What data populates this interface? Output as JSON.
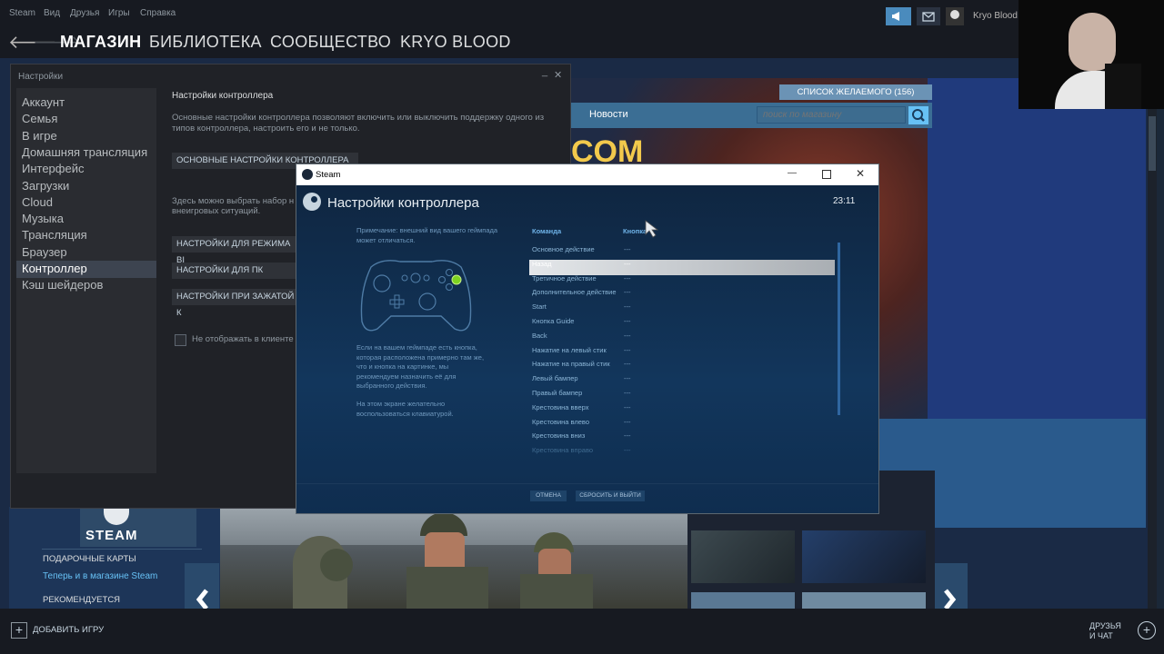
{
  "topmenu": {
    "items": [
      "Steam",
      "Вид",
      "Друзья",
      "Игры",
      "Справка"
    ]
  },
  "nav": {
    "tabs": [
      "МАГАЗИН",
      "БИБЛИОТЕКА",
      "СООБЩЕСТВО",
      "KRYO BLOOD"
    ],
    "username": "Kryo Blood"
  },
  "store": {
    "wishlist": "СПИСОК ЖЕЛАЕМОГО (156)",
    "news": "Новости",
    "search_placeholder": "поиск по магазину",
    "brand_fragment": "COM",
    "steam_logo": "STEAM",
    "gift_cards": "ПОДАРОЧНЫЕ КАРТЫ",
    "now_in_store": "Теперь и в магазине Steam",
    "recommended": "РЕКОМЕНДУЕТСЯ"
  },
  "settings": {
    "title": "Настройки",
    "close_label": "✕",
    "min_label": "_",
    "sidebar": [
      "Аккаунт",
      "Семья",
      "В игре",
      "Домашняя трансляция",
      "Интерфейс",
      "Загрузки",
      "Cloud",
      "Музыка",
      "Трансляция",
      "Браузер",
      "Контроллер",
      "Кэш шейдеров"
    ],
    "active_index": 10,
    "section_title": "Настройки контроллера",
    "section_desc": "Основные настройки контроллера позволяют включить или выключить поддержку одного из типов контроллера, настроить его и не только.",
    "btn_general": "ОСНОВНЫЕ НАСТРОЙКИ КОНТРОЛЛЕРА",
    "para2_line1": "Здесь можно выбрать набор н",
    "para2_line2": "внеигровых ситуаций.",
    "btn_bigpicture": "НАСТРОЙКИ ДЛЯ РЕЖИМА BI",
    "btn_pc": "НАСТРОЙКИ ДЛЯ ПК",
    "btn_hold": "НАСТРОЙКИ ПРИ ЗАЖАТОЙ К",
    "checkbox_label": "Не отображать в клиенте"
  },
  "dialog": {
    "window_title": "Steam",
    "title": "Настройки контроллера",
    "clock": "23:11",
    "note": "Примечание: внешний вид вашего геймпада может отличаться.",
    "help1": "Если на вашем геймпаде есть кнопка, которая расположена примерно там же, что и кнопка на картинке, мы рекомендуем назначить её для выбранного действия.",
    "help2": "На этом экране желательно воспользоваться клавиатурой.",
    "col_command": "Команда",
    "col_button": "Кнопка",
    "rows": [
      {
        "command": "Основное действие",
        "key": "---"
      },
      {
        "command": "Назад",
        "key": "---"
      },
      {
        "command": "Третичное действие",
        "key": "---"
      },
      {
        "command": "Дополнительное действие",
        "key": "---"
      },
      {
        "command": "Start",
        "key": "---"
      },
      {
        "command": "Кнопка Guide",
        "key": "---"
      },
      {
        "command": "Back",
        "key": "---"
      },
      {
        "command": "Нажатие на левый стик",
        "key": "---"
      },
      {
        "command": "Нажатие на правый стик",
        "key": "---"
      },
      {
        "command": "Левый бампер",
        "key": "---"
      },
      {
        "command": "Правый бампер",
        "key": "---"
      },
      {
        "command": "Крестовина вверх",
        "key": "---"
      },
      {
        "command": "Крестовина влево",
        "key": "---"
      },
      {
        "command": "Крестовина вниз",
        "key": "---"
      },
      {
        "command": "Крестовина вправо",
        "key": "---"
      }
    ],
    "selected_index": 1,
    "btn_cancel": "ОТМЕНА",
    "btn_reset": "СБРОСИТЬ И ВЫЙТИ"
  },
  "bottom": {
    "add_game": "ДОБАВИТЬ ИГРУ",
    "friends_line1": "ДРУЗЬЯ",
    "friends_line2": "И ЧАТ"
  }
}
